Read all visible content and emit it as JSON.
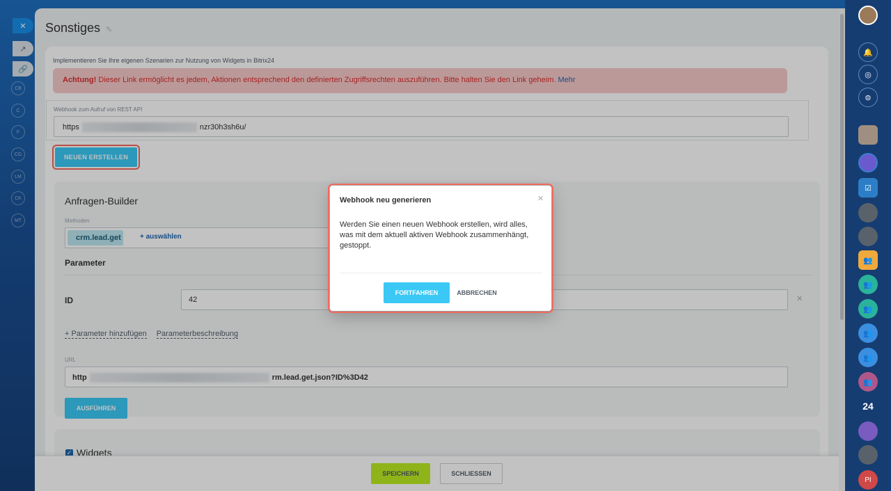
{
  "panel": {
    "title": "Sonstiges",
    "intro": "Implementieren Sie Ihre eigenen Szenarien zur Nutzung von Widgets in Bitrix24",
    "alert_strong": "Achtung!",
    "alert_text": " Dieser Link ermöglicht es jedem, Aktionen entsprechend den definierten Zugriffsrechten auszuführen. Bitte halten Sie den Link geheim. ",
    "alert_link": "Mehr",
    "webhook_label": "Webhook zum Aufruf von REST API",
    "webhook_prefix": "https",
    "webhook_suffix": "nzr30h3sh6u/",
    "new_button": "NEUEN ERSTELLEN"
  },
  "builder": {
    "title": "Anfragen-Builder",
    "methods_label": "Methoden",
    "method_chip": "crm.lead.get",
    "method_add": "+ auswählen",
    "params_title": "Parameter",
    "id_label": "ID",
    "id_value": "42",
    "add_param_link": "+ Parameter hinzufügen",
    "param_desc_link": "Parameterbeschreibung",
    "url_label": "URL",
    "url_prefix": "http",
    "url_suffix": "rm.lead.get.json?ID%3D42",
    "run_button": "AUSFÜHREN"
  },
  "widgets": {
    "label": "Widgets",
    "checked": true
  },
  "footer": {
    "save": "SPEICHERN",
    "close": "SCHLIESSEN"
  },
  "modal": {
    "title": "Webhook neu generieren",
    "body": "Werden Sie einen neuen Webhook erstellen, wird alles, was mit dem aktuell aktiven Webhook zusammenhängt, gestoppt.",
    "continue": "FORTFAHREN",
    "cancel": "ABBRECHEN"
  },
  "left_rail": [
    "CB",
    "C",
    "F",
    "CG",
    "LM",
    "CK",
    "MT"
  ],
  "right_rail": {
    "counter": "24",
    "initials": "PI"
  },
  "colors": {
    "accent": "#3bc8f5",
    "save": "#bbed21",
    "alert_bg": "#f7c9c9",
    "alert_text": "#d92d2d",
    "highlight": "#f16a5d"
  }
}
